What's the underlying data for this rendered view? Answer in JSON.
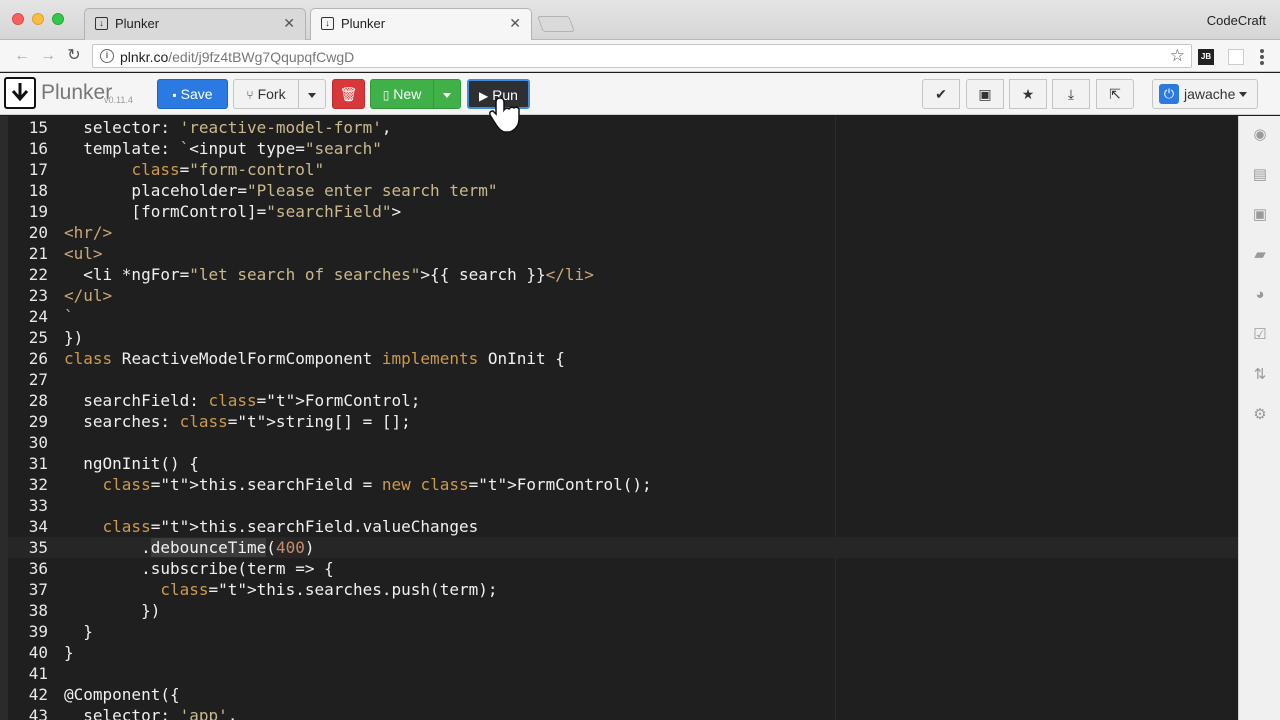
{
  "browser": {
    "tabs": [
      {
        "title": "Plunker",
        "active": false
      },
      {
        "title": "Plunker",
        "active": true
      }
    ],
    "profile_name": "CodeCraft",
    "url_host": "plnkr.co",
    "url_path": "/edit/j9fz4tBWg7QqupqfCwgD",
    "ext_jb": "JB"
  },
  "toolbar": {
    "logo_text": "Plunker",
    "logo_version": "v0.11.4",
    "save_label": "Save",
    "fork_label": "Fork",
    "new_label": "New",
    "run_label": "Run",
    "username": "jawache"
  },
  "colors": {
    "save": "#2a7ae2",
    "delete": "#d9383a",
    "new": "#3fb148",
    "run_border": "#3b8ede"
  },
  "editor": {
    "current_line": 35,
    "lines": [
      {
        "n": "15",
        "code": "  selector: 'reactive-model-form',"
      },
      {
        "n": "16",
        "code": "  template: `<input type=\"search\""
      },
      {
        "n": "17",
        "code": "       class=\"form-control\""
      },
      {
        "n": "18",
        "code": "       placeholder=\"Please enter search term\""
      },
      {
        "n": "19",
        "code": "       [formControl]=\"searchField\">"
      },
      {
        "n": "20",
        "code": "<hr/>"
      },
      {
        "n": "21",
        "code": "<ul>"
      },
      {
        "n": "22",
        "code": "  <li *ngFor=\"let search of searches\">{{ search }}</li>"
      },
      {
        "n": "23",
        "code": "</ul>"
      },
      {
        "n": "24",
        "code": "`"
      },
      {
        "n": "25",
        "code": "})"
      },
      {
        "n": "26",
        "code": "class ReactiveModelFormComponent implements OnInit {"
      },
      {
        "n": "27",
        "code": ""
      },
      {
        "n": "28",
        "code": "  searchField: FormControl;"
      },
      {
        "n": "29",
        "code": "  searches: string[] = [];"
      },
      {
        "n": "30",
        "code": ""
      },
      {
        "n": "31",
        "code": "  ngOnInit() {"
      },
      {
        "n": "32",
        "code": "    this.searchField = new FormControl();"
      },
      {
        "n": "33",
        "code": ""
      },
      {
        "n": "34",
        "code": "    this.searchField.valueChanges"
      },
      {
        "n": "35",
        "code": "        .debounceTime(400)"
      },
      {
        "n": "36",
        "code": "        .subscribe(term => {"
      },
      {
        "n": "37",
        "code": "          this.searches.push(term);"
      },
      {
        "n": "38",
        "code": "        })"
      },
      {
        "n": "39",
        "code": "  }"
      },
      {
        "n": "40",
        "code": "}"
      },
      {
        "n": "41",
        "code": ""
      },
      {
        "n": "42",
        "code": "@Component({"
      },
      {
        "n": "43",
        "code": "  selector: 'app',"
      }
    ]
  },
  "sidebar": {
    "icons": [
      "eye-icon",
      "book-icon",
      "briefcase-icon",
      "comments-icon",
      "dashboard-icon",
      "check-square-icon",
      "retweet-icon",
      "gear-icon"
    ]
  }
}
